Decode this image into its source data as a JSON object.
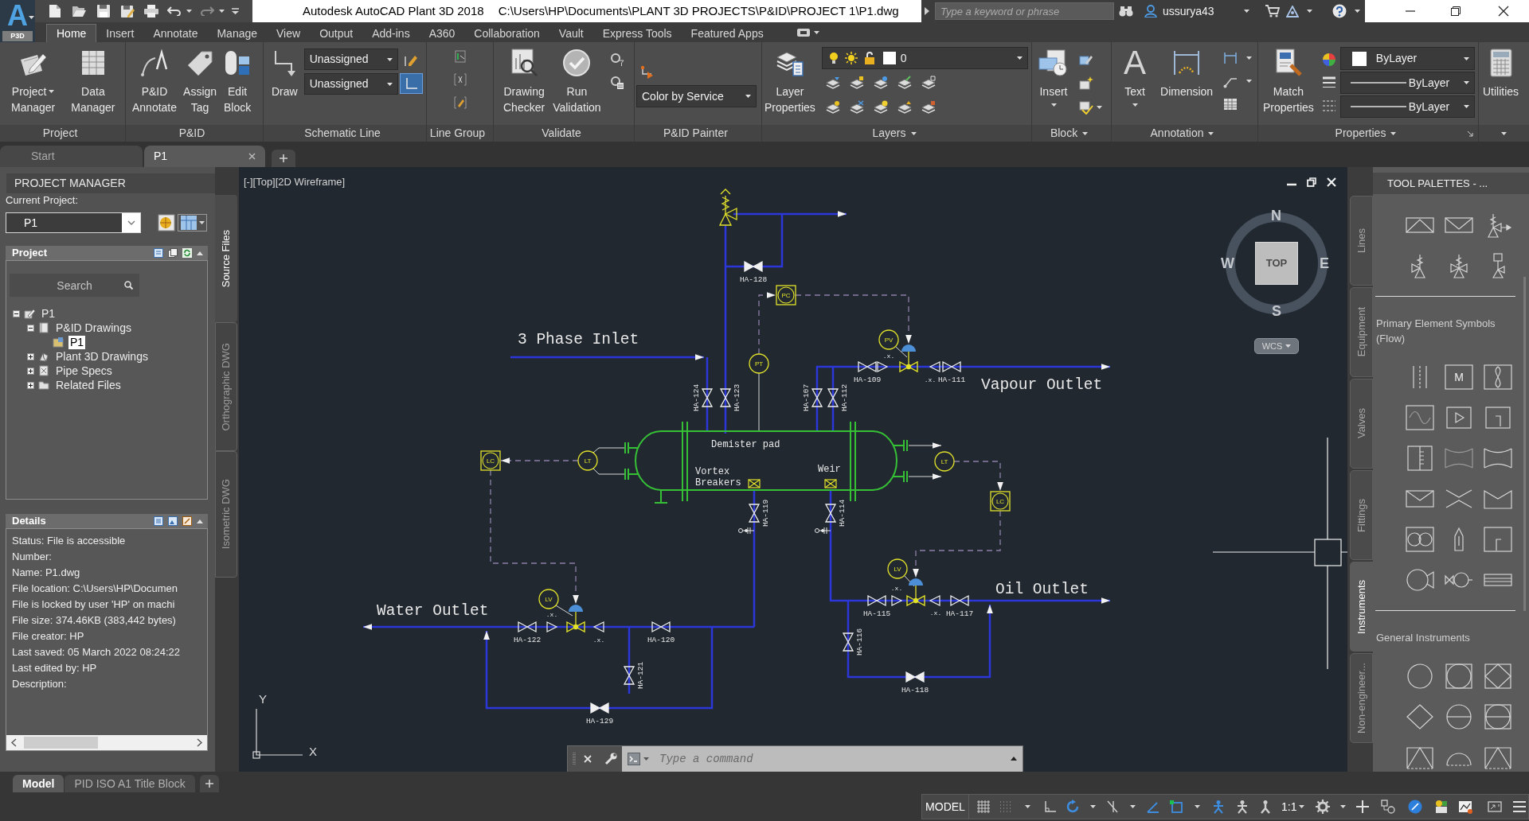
{
  "title_bar": {
    "logo_letter": "A",
    "badge": "P3D",
    "app_title": "Autodesk AutoCAD Plant 3D 2018",
    "file_path": "C:\\Users\\HP\\Documents\\PLANT 3D PROJECTS\\P&ID\\PROJECT 1\\P1.dwg",
    "search_placeholder": "Type a keyword or phrase",
    "user": "ussurya43"
  },
  "ribbon": {
    "tabs": [
      {
        "label": "Home",
        "selected": true
      },
      {
        "label": "Insert",
        "selected": false
      },
      {
        "label": "Annotate",
        "selected": false
      },
      {
        "label": "Manage",
        "selected": false
      },
      {
        "label": "View",
        "selected": false
      },
      {
        "label": "Output",
        "selected": false
      },
      {
        "label": "Add-ins",
        "selected": false
      },
      {
        "label": "A360",
        "selected": false
      },
      {
        "label": "Collaboration",
        "selected": false
      },
      {
        "label": "Vault",
        "selected": false
      },
      {
        "label": "Express Tools",
        "selected": false
      },
      {
        "label": "Featured Apps",
        "selected": false
      }
    ],
    "panels": [
      {
        "title": "Project",
        "menu": false,
        "buttons": [
          {
            "lines": [
              "Project",
              "Manager"
            ],
            "menu": true
          },
          {
            "lines": [
              "Data",
              "Manager"
            ],
            "menu": false
          }
        ]
      },
      {
        "title": "P&ID",
        "menu": false,
        "buttons": [
          {
            "lines": [
              "P&ID",
              "Annotate"
            ],
            "menu": false
          },
          {
            "lines": [
              "Assign",
              "Tag"
            ],
            "menu": false
          },
          {
            "lines": [
              "Edit",
              "Block"
            ],
            "menu": false
          }
        ]
      },
      {
        "title": "Schematic Line",
        "menu": false,
        "buttons": [
          {
            "lines": [
              "Draw"
            ],
            "menu": false
          }
        ],
        "dropdowns": [
          "Unassigned",
          "Unassigned"
        ]
      },
      {
        "title": "Line Group",
        "menu": false
      },
      {
        "title": "Validate",
        "menu": false,
        "buttons": [
          {
            "lines": [
              "Drawing",
              "Checker"
            ],
            "menu": false
          },
          {
            "lines": [
              "Run",
              "Validation"
            ],
            "menu": false
          }
        ]
      },
      {
        "title": "P&ID Painter",
        "menu": false,
        "dropdowns": [
          "Color by Service"
        ]
      },
      {
        "title": "Layers",
        "menu": true,
        "buttons": [
          {
            "lines": [
              "Layer",
              "Properties"
            ],
            "menu": false
          }
        ],
        "dropdowns": [
          "0"
        ]
      },
      {
        "title": "Block",
        "menu": true,
        "buttons": [
          {
            "lines": [
              "Insert"
            ],
            "menu": true
          }
        ]
      },
      {
        "title": "Annotation",
        "menu": true,
        "buttons": [
          {
            "glyph": "A",
            "lines": [
              "Text"
            ],
            "menu": true
          },
          {
            "lines": [
              "Dimension"
            ],
            "menu": false
          }
        ]
      },
      {
        "title": "Properties",
        "menu": true,
        "buttons": [
          {
            "lines": [
              "Match",
              "Properties"
            ],
            "menu": false
          }
        ],
        "dropdowns": [
          "ByLayer",
          "ByLayer",
          "ByLayer"
        ]
      },
      {
        "menu": true,
        "buttons": [
          {
            "lines": [
              "Utilities"
            ],
            "menu": false
          }
        ]
      }
    ]
  },
  "document_tabs": [
    {
      "label": "Start",
      "selected": false,
      "closable": false
    },
    {
      "label": "P1",
      "selected": true,
      "closable": true
    }
  ],
  "project_manager": {
    "title": "PROJECT MANAGER",
    "current_project_label": "Current Project:",
    "current_project": "P1",
    "project_section": "Project",
    "search_placeholder": "Search",
    "tree": [
      {
        "label": "P1",
        "kind": "project",
        "expanded": true,
        "selected": false,
        "children": [
          {
            "label": "P&ID Drawings",
            "kind": "drawings",
            "expanded": true,
            "selected": false,
            "children": [
              {
                "label": "P1",
                "kind": "drawing",
                "selected": true
              }
            ]
          },
          {
            "label": "Plant 3D Drawings",
            "kind": "models",
            "expanded": false,
            "selected": false
          },
          {
            "label": "Pipe Specs",
            "kind": "specs",
            "expanded": false,
            "selected": false
          },
          {
            "label": "Related Files",
            "kind": "files",
            "expanded": false,
            "selected": false
          }
        ]
      }
    ],
    "details_section": "Details",
    "details": [
      "Status: File is accessible",
      "Number:",
      "Name: P1.dwg",
      "File location: C:\\Users\\HP\\Documen",
      "File is locked by user 'HP' on machi",
      "File size: 374.46KB (383,442 bytes)",
      "File creator: HP",
      "Last saved: 05 March 2022 08:24:22",
      "Last edited by: HP",
      "Description:"
    ]
  },
  "left_side_tabs": [
    {
      "label": "Source Files",
      "selected": true
    },
    {
      "label": "Orthographic DWG",
      "selected": false
    },
    {
      "label": "Isometric DWG",
      "selected": false
    }
  ],
  "viewport": {
    "label": "[-][Top][2D Wireframe]",
    "viewcube": {
      "face": "TOP",
      "north": "N",
      "east": "E",
      "south": "S",
      "west": "W",
      "ucs_menu": "WCS"
    },
    "ucs": {
      "x": "X",
      "y": "Y"
    },
    "command_placeholder": "Type a command",
    "diagram": {
      "stream_labels": [
        "3 Phase Inlet",
        "Vapour Outlet",
        "Oil Outlet",
        "Water Outlet"
      ],
      "vessel_labels": [
        {
          "lines": [
            "Demister pad"
          ]
        },
        {
          "lines": [
            "Vortex",
            "Breakers"
          ]
        },
        {
          "lines": [
            "Weir"
          ]
        }
      ],
      "valves": [
        {
          "tag": "HA-128",
          "closed": true
        },
        {
          "tag": "HA-124",
          "closed": false
        },
        {
          "tag": "HA-123",
          "closed": false
        },
        {
          "tag": "HA-107",
          "closed": false
        },
        {
          "tag": "HA-112",
          "closed": false
        },
        {
          "tag": "HA-109",
          "closed": false
        },
        {
          "tag": "HA-111",
          "closed": false
        },
        {
          "tag": "HA-119",
          "closed": false
        },
        {
          "tag": "HA-114",
          "closed": false
        },
        {
          "tag": "HA-115",
          "closed": false
        },
        {
          "tag": "HA-117",
          "closed": false
        },
        {
          "tag": "HA-116",
          "closed": false
        },
        {
          "tag": "HA-118",
          "closed": true
        },
        {
          "tag": "HA-122",
          "closed": false
        },
        {
          "tag": "HA-120",
          "closed": false
        },
        {
          "tag": "HA-121",
          "closed": false
        },
        {
          "tag": "HA-129",
          "closed": true
        }
      ],
      "instruments": [
        {
          "tag": "PC",
          "kind": "panel"
        },
        {
          "tag": "PV",
          "kind": "field"
        },
        {
          "tag": "PT",
          "kind": "field"
        },
        {
          "tag": "LC",
          "kind": "panel"
        },
        {
          "tag": "LT",
          "kind": "field"
        },
        {
          "tag": "LT",
          "kind": "field"
        },
        {
          "tag": "LC",
          "kind": "panel"
        },
        {
          "tag": "LV",
          "kind": "field"
        },
        {
          "tag": "LV",
          "kind": "field"
        }
      ],
      "control_valves": [
        {
          "marks": [
            ".x.",
            ".x."
          ]
        },
        {
          "marks": [
            ".x.",
            ".x."
          ]
        },
        {
          "marks": [
            ".x.",
            ".x."
          ]
        }
      ]
    }
  },
  "tool_palette": {
    "title": "TOOL PALETTES - ...",
    "tabs": [
      {
        "label": "Lines",
        "selected": false
      },
      {
        "label": "Equipment",
        "selected": false
      },
      {
        "label": "Valves",
        "selected": false
      },
      {
        "label": "Fittings",
        "selected": false
      },
      {
        "label": "Instruments",
        "selected": true
      },
      {
        "label": "Non-engineer...",
        "selected": false
      }
    ],
    "headings": [
      "Primary Element Symbols (Flow)",
      "General Instruments"
    ],
    "symbol_letter": "M"
  },
  "layout_tabs": [
    {
      "label": "Model",
      "selected": true
    },
    {
      "label": "PID ISO A1 Title Block",
      "selected": false
    }
  ],
  "status_bar": {
    "mode": "MODEL",
    "annotation_scale": "1:1"
  }
}
